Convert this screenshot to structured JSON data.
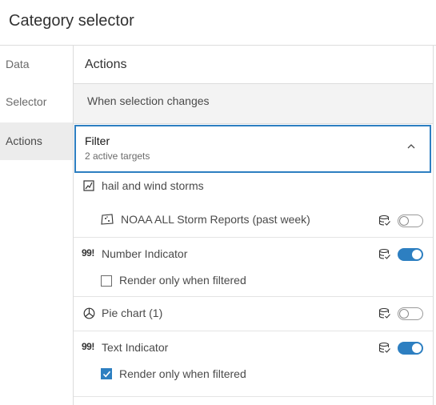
{
  "header": {
    "title": "Category selector"
  },
  "nav": {
    "items": [
      {
        "label": "Data",
        "active": false
      },
      {
        "label": "Selector",
        "active": false
      },
      {
        "label": "Actions",
        "active": true
      }
    ]
  },
  "panel": {
    "title": "Actions",
    "section_label": "When selection changes",
    "filter": {
      "title": "Filter",
      "subtitle": "2 active targets",
      "expanded": true
    },
    "targets": [
      {
        "label": "hail and wind storms",
        "icon": "map-icon"
      },
      {
        "label": "NOAA ALL Storm Reports (past week)",
        "icon": "layer-map-icon",
        "enabled": false
      },
      {
        "label": "Number Indicator",
        "icon": "99!",
        "enabled": true,
        "render_option": "Render only when filtered",
        "render_checked": false
      },
      {
        "label": "Pie chart (1)",
        "icon": "pie-chart-icon",
        "enabled": false
      },
      {
        "label": "Text Indicator",
        "icon": "99!",
        "enabled": true,
        "render_option": "Render only when filtered",
        "render_checked": true
      }
    ]
  },
  "colors": {
    "accent": "#2d7fc1",
    "nav_active_bg": "#ececec",
    "section_bg": "#f3f3f3"
  }
}
